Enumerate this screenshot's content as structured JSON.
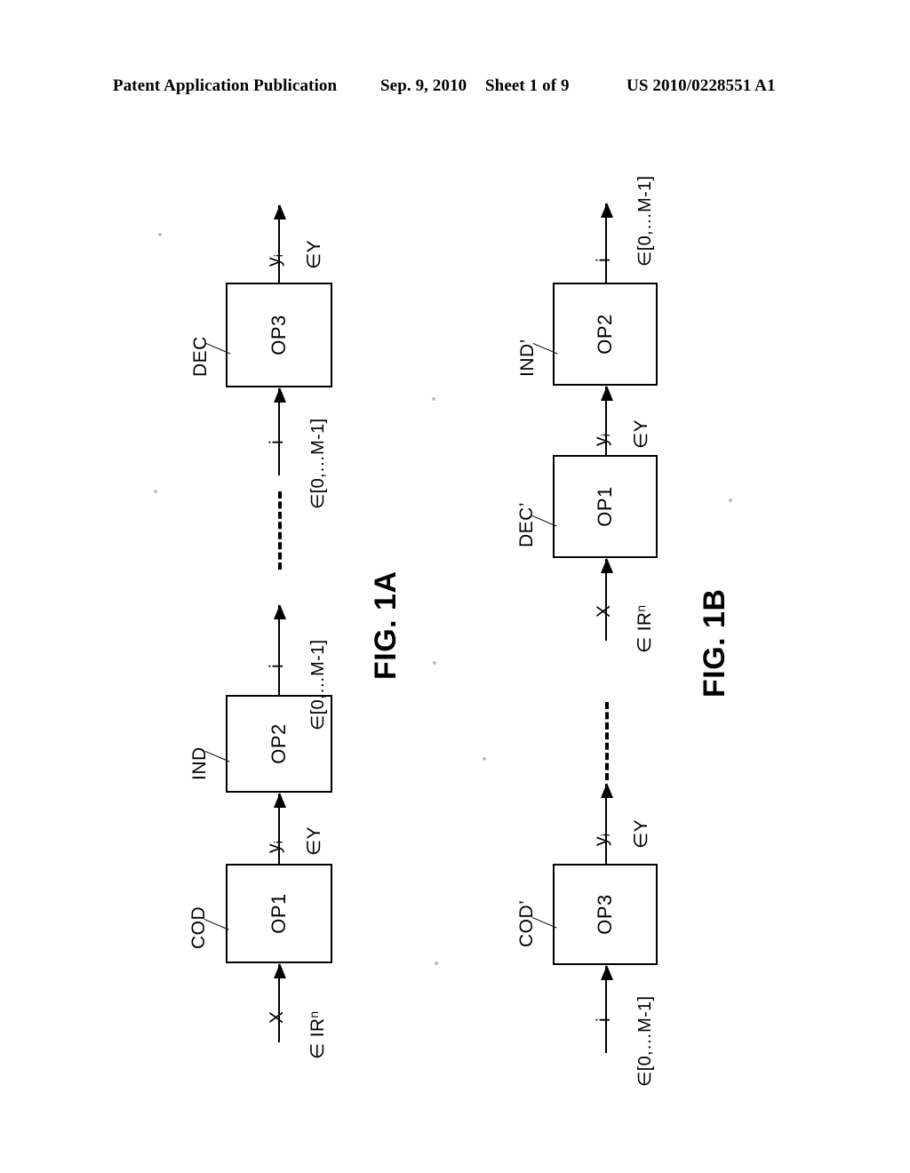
{
  "header": {
    "publication": "Patent Application Publication",
    "date": "Sep. 9, 2010",
    "sheet": "Sheet 1 of 9",
    "number": "US 2010/0228551 A1"
  },
  "figures": [
    {
      "caption": "FIG. 1A",
      "blocks": [
        {
          "name": "OP1",
          "ref": "COD"
        },
        {
          "name": "OP2",
          "ref": "IND"
        },
        {
          "name": "OP3",
          "ref": "DEC"
        }
      ],
      "signals": [
        {
          "symbol": "X",
          "domain": "∈ IR",
          "exponent": "n",
          "subscript": ""
        },
        {
          "symbol": "y",
          "domain": "∈Y",
          "exponent": "",
          "subscript": "i"
        },
        {
          "symbol": "i",
          "domain": "∈[0,…M-1]",
          "exponent": "",
          "subscript": ""
        },
        {
          "symbol": "i",
          "domain": "∈[0,…M-1]",
          "exponent": "",
          "subscript": ""
        },
        {
          "symbol": "y",
          "domain": "∈Y",
          "exponent": "",
          "subscript": "i"
        }
      ]
    },
    {
      "caption": "FIG. 1B",
      "blocks": [
        {
          "name": "OP3",
          "ref": "COD’"
        },
        {
          "name": "OP1",
          "ref": "DEC’"
        },
        {
          "name": "OP2",
          "ref": "IND’"
        }
      ],
      "signals": [
        {
          "symbol": "i",
          "domain": "∈[0,…M-1]",
          "exponent": "",
          "subscript": ""
        },
        {
          "symbol": "y",
          "domain": "∈Y",
          "exponent": "",
          "subscript": "i"
        },
        {
          "symbol": "X",
          "domain": "∈ IR",
          "exponent": "n",
          "subscript": ""
        },
        {
          "symbol": "y",
          "domain": "∈Y",
          "exponent": "",
          "subscript": "i"
        },
        {
          "symbol": "i",
          "domain": "∈[0,…M-1]",
          "exponent": "",
          "subscript": ""
        }
      ]
    }
  ],
  "labels": {
    "fig1a": {
      "op1": "OP1",
      "op2": "OP2",
      "op3": "OP3",
      "cod": "COD",
      "ind": "IND",
      "dec": "DEC",
      "in_x": "X",
      "in_x_dom": "∈ IR",
      "sig_y": "y",
      "sig_y_sub": "i",
      "sig_y_dom": "∈Y",
      "sig_i": "i",
      "sig_i_dom": "∈[0,…M-1]",
      "out_y": "y",
      "out_y_sub": "i",
      "out_y_dom": "∈Y",
      "caption": "FIG. 1A"
    },
    "fig1b": {
      "op3": "OP3",
      "op1": "OP1",
      "op2": "OP2",
      "cod": "COD’",
      "dec": "DEC’",
      "ind": "IND’",
      "in_i": "i",
      "in_i_dom": "∈[0,…M-1]",
      "sig_y1": "y",
      "sig_y1_sub": "i",
      "sig_y1_dom": "∈Y",
      "sig_x": "X",
      "sig_x_dom": "∈ IR",
      "sig_y2": "y",
      "sig_y2_sub": "i",
      "sig_y2_dom": "∈Y",
      "out_i": "i",
      "out_i_dom": "∈[0,…M-1]",
      "caption": "FIG. 1B"
    },
    "exp_n": "n"
  },
  "colors": {
    "ink": "#000000",
    "paper": "#ffffff"
  }
}
